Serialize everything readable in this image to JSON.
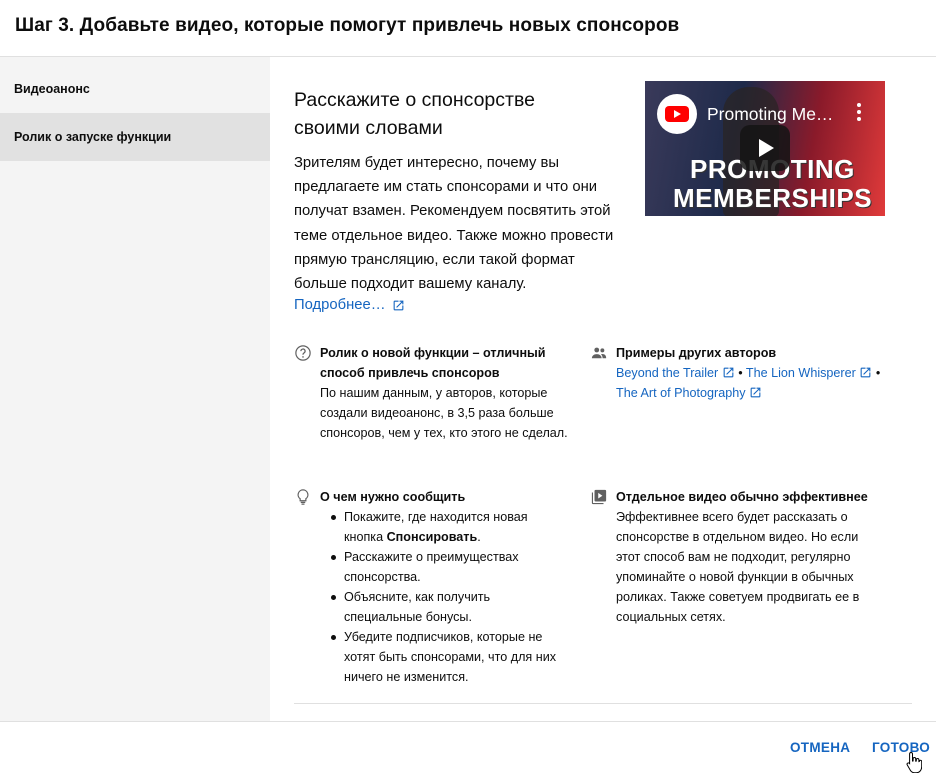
{
  "header": {
    "title": "Шаг 3. Добавьте видео, которые помогут привлечь новых спонсоров"
  },
  "sidebar": {
    "items": [
      {
        "label": "Видеоанонс",
        "selected": false
      },
      {
        "label": "Ролик о запуске функции",
        "selected": true
      }
    ]
  },
  "main": {
    "intro_title": "Расскажите о спонсорстве своими словами",
    "intro_text": "Зрителям будет интересно, почему вы предлагаете им стать спонсорами и что они получат взамен. Рекомендуем посвятить этой теме отдельное видео. Также можно провести прямую трансляцию, если такой формат больше подходит вашему каналу.",
    "more_link": "Подробнее…",
    "video": {
      "title": "Promoting Me…",
      "overlay_line1": "PROMOTING",
      "overlay_line2": "MEMBERSHIPS"
    },
    "block_new_feature": {
      "icon": "help-circle-icon",
      "title": "Ролик о новой функции – отличный способ привлечь спонсоров",
      "text": "По нашим данным, у авторов, которые создали видеоанонс, в 3,5 раза больше спонсоров, чем у тех, кто этого не сделал."
    },
    "block_examples": {
      "icon": "people-icon",
      "title": "Примеры других авторов",
      "links": [
        "Beyond the Trailer",
        "The Lion Whisperer",
        "The Art of Photography"
      ],
      "separator": "•"
    },
    "block_what_to_say": {
      "icon": "lightbulb-icon",
      "title": "О чем нужно сообщить",
      "item0_prefix": "Покажите, где находится новая кнопка ",
      "item0_bold": "Спонсировать",
      "item0_suffix": ".",
      "item1": "Расскажите о преимуществах спонсорства.",
      "item2": "Объясните, как получить специальные бонусы.",
      "item3": "Убедите подписчиков, которые не хотят быть спонсорами, что для них ничего не изменится."
    },
    "block_separate_video": {
      "icon": "video-library-icon",
      "title": "Отдельное видео обычно эффективнее",
      "text": "Эффективнее всего будет рассказать о спонсорстве в отдельном видео. Но если этот способ вам не подходит, регулярно упоминайте о новой функции в обычных роликах. Также советуем продвигать ее в социальных сетях."
    }
  },
  "footer": {
    "cancel_label": "ОТМЕНА",
    "done_label": "ГОТОВО"
  },
  "colors": {
    "link": "#1565c0",
    "sidebar_bg": "#f4f4f4",
    "sidebar_selected": "#e1e1e1"
  }
}
